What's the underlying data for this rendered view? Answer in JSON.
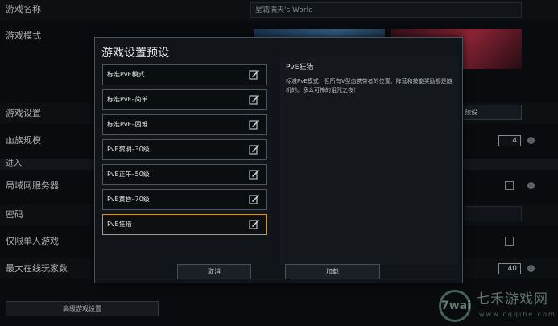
{
  "settings": {
    "game_name_label": "游戏名称",
    "game_name_value": "星霜满天's World",
    "game_mode_label": "游戏模式",
    "game_settings_label": "游戏设置",
    "preset_button_label": "预设",
    "clan_size_label": "血族规模",
    "clan_size_value": "4",
    "section_join": "进入",
    "lan_server_label": "局域网服务器",
    "password_label": "密码",
    "single_player_label": "仅限单人游戏",
    "max_players_label": "最大在线玩家数",
    "max_players_value": "40",
    "advanced_button_label": "高级游戏设置"
  },
  "modal": {
    "title": "游戏设置预设",
    "presets": [
      {
        "label": "标准PvE模式"
      },
      {
        "label": "标准PvE–简单"
      },
      {
        "label": "标准PvE–困难"
      },
      {
        "label": "PvE黎明–30级"
      },
      {
        "label": "PvE正午–50级"
      },
      {
        "label": "PvE黄昏–70级"
      },
      {
        "label": "PvE狂猎"
      }
    ],
    "selected_index": 6,
    "detail_title": "PvE狂猎",
    "detail_description": "标准PvE模式，但所有V型血携带者的位置、阵营和技能奖励都是随机的。多么可怖的诅咒之夜！",
    "cancel_label": "取消",
    "load_label": "加载"
  },
  "watermark": {
    "logo_text": "7wai",
    "brand": "七禾游戏网",
    "url": "www.cqqihe.com"
  },
  "colors": {
    "selected_border": "#c59a3a",
    "background": "#0b0e12"
  }
}
